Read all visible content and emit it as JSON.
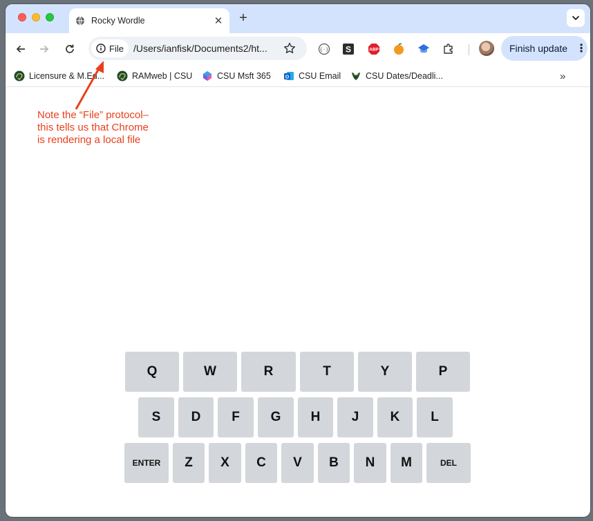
{
  "tab": {
    "title": "Rocky Wordle",
    "close": "✕",
    "new_tab": "+"
  },
  "omnibox": {
    "protocol_chip": "File",
    "url": "/Users/ianfisk/Documents2/ht..."
  },
  "toolbar": {
    "finish_update_label": "Finish update",
    "menu_glyph": "⋮"
  },
  "extensions": [
    {
      "name": "devtools-extension-icon"
    },
    {
      "name": "s-extension-icon",
      "label": "S"
    },
    {
      "name": "adblock-plus-icon",
      "label": "ABP"
    },
    {
      "name": "orange-extension-icon"
    },
    {
      "name": "blue-extension-icon"
    },
    {
      "name": "puzzle-extensions-icon"
    }
  ],
  "bookmarks": [
    {
      "label": "Licensure & M.Ed..."
    },
    {
      "label": "RAMweb | CSU"
    },
    {
      "label": "CSU Msft 365"
    },
    {
      "label": "CSU Email"
    },
    {
      "label": "CSU Dates/Deadli..."
    }
  ],
  "bookmarks_more": "»",
  "annotation": {
    "line1": "Note the “File” protocol–",
    "line2": "this tells us that Chrome",
    "line3": "is rendering a local file",
    "color": "#e8401c"
  },
  "keyboard": {
    "row1": [
      "Q",
      "W",
      "R",
      "T",
      "Y",
      "P"
    ],
    "row2": [
      "S",
      "D",
      "F",
      "G",
      "H",
      "J",
      "K",
      "L"
    ],
    "row3": [
      "ENTER",
      "Z",
      "X",
      "C",
      "V",
      "B",
      "N",
      "M",
      "DEL"
    ]
  },
  "colors": {
    "tabstrip": "#d3e3fd",
    "key": "#d3d6da",
    "finish_button": "#d3e3fd"
  }
}
